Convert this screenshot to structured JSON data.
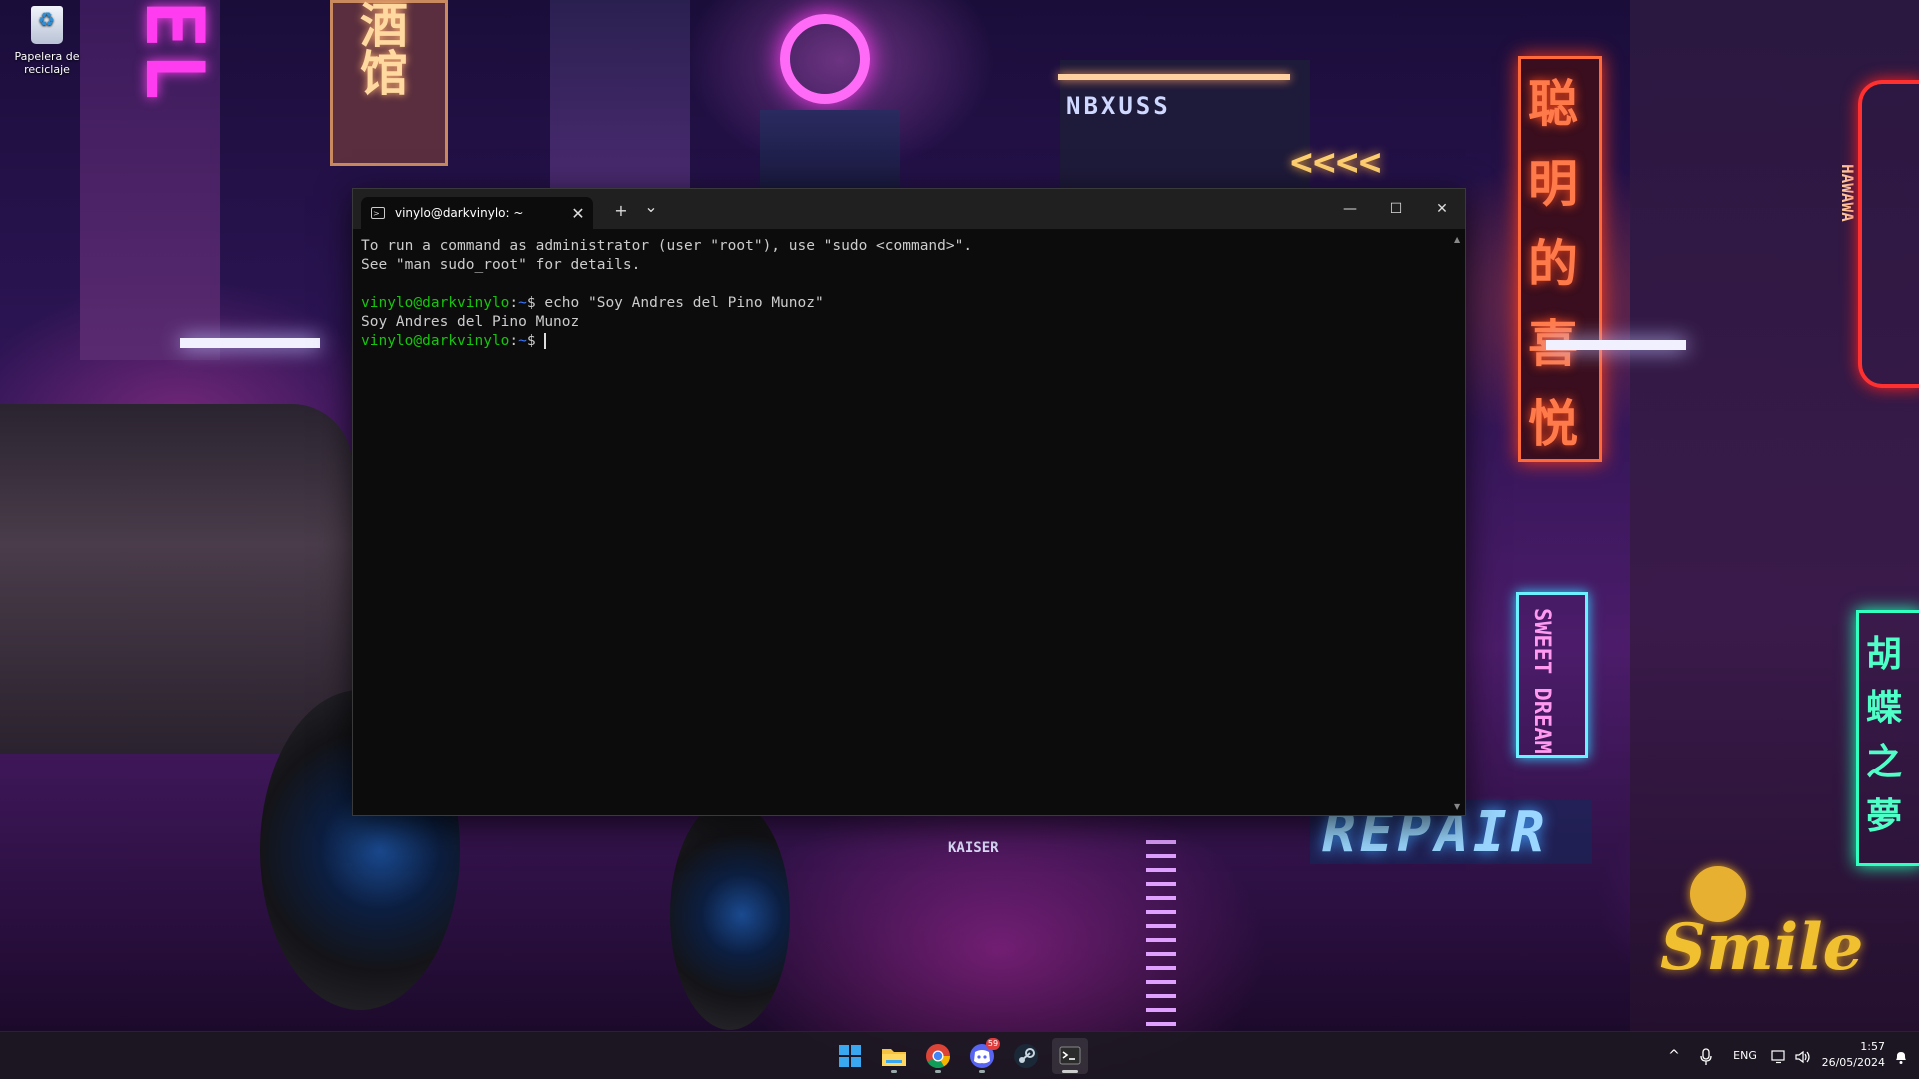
{
  "desktop": {
    "recycle_bin_label": "Papelera de reciclaje",
    "wallpaper_signs": {
      "left_vertical": "EL",
      "chinese_left": "酒馆",
      "nexus": "NBXUSS",
      "arrows": "<<<<",
      "chinese_right": [
        "聪",
        "明",
        "的",
        "喜",
        "悦"
      ],
      "sweet_dream": "SWEET DREAM",
      "repair": "REPAIR",
      "chinese_far_right": [
        "胡",
        "蝶",
        "之",
        "夢"
      ],
      "hawawa": "HAWAWA",
      "smile": "Smile",
      "kaiser": "KAISER"
    }
  },
  "terminal": {
    "tab_title": "vinylo@darkvinylo: ~",
    "tab_close": "✕",
    "new_tab": "+",
    "dropdown": "⌄",
    "minimize": "—",
    "maximize": "☐",
    "close": "✕",
    "lines": {
      "l1": "To run a command as administrator (user \"root\"), use \"sudo <command>\".",
      "l2": "See \"man sudo_root\" for details.",
      "prompt_user": "vinylo@darkvinylo",
      "prompt_path": "~",
      "prompt_sep": ":",
      "prompt_end": "$ ",
      "command": "echo \"Soy Andres del Pino Munoz\"",
      "output": "Soy Andres del Pino Munoz"
    }
  },
  "taskbar": {
    "apps": [
      {
        "name": "start-icon"
      },
      {
        "name": "file-explorer-icon"
      },
      {
        "name": "chrome-icon"
      },
      {
        "name": "discord-icon",
        "badge": "59"
      },
      {
        "name": "steam-icon"
      },
      {
        "name": "terminal-icon"
      }
    ],
    "tray": {
      "chevron": "^",
      "language": "ENG",
      "time": "1:57",
      "date": "26/05/2024"
    }
  }
}
